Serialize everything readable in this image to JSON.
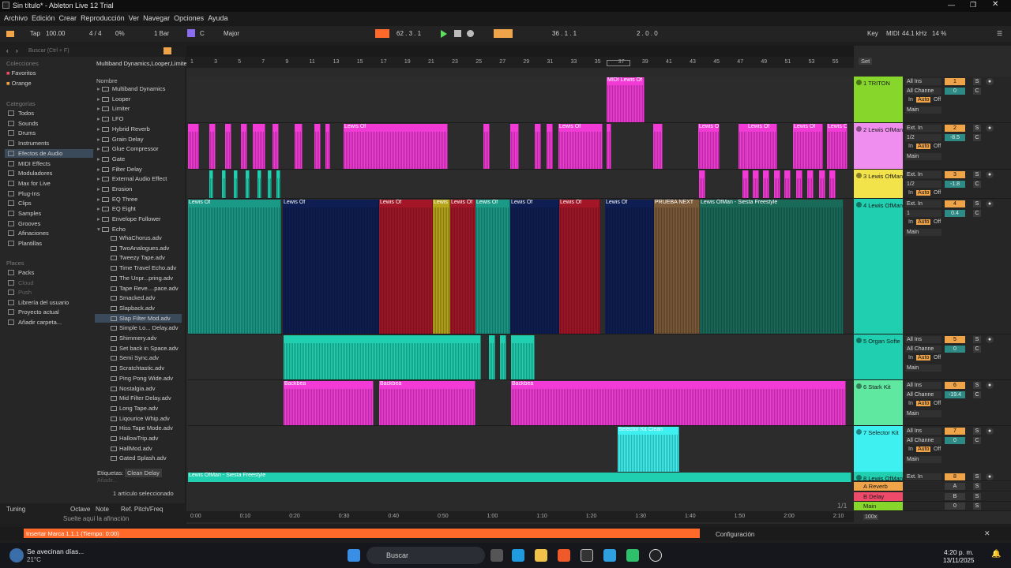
{
  "title": "Sin título* - Ableton Live 12 Trial",
  "menu": [
    "Archivo",
    "Edición",
    "Crear",
    "Reproducción",
    "Ver",
    "Navegar",
    "Opciones",
    "Ayuda"
  ],
  "toolbar": {
    "tap": "Tap",
    "tempo": "100.00",
    "sig": "4 / 4",
    "pct": "0%",
    "quant": "1 Bar",
    "key": "C",
    "scale": "Major",
    "pos": "62 . 3 . 1",
    "loop": "36 . 1 . 1",
    "len": "2 . 0 . 0",
    "key_label": "Key",
    "midi": "MIDI",
    "rate": "44.1 kHz",
    "cpu": "14 %"
  },
  "browser": {
    "search": "Buscar (Ctrl + F)",
    "devices": [
      "Multiband Dynamics",
      "Looper",
      "Limiter",
      "LFO",
      "Hybrid Reverb",
      "Grain Delay",
      "Glue Compressor",
      "Gate",
      "Filter Delay",
      "External Audio Effect",
      "Erosion",
      "EQ Three",
      "EQ Eight",
      "Envelope Follower",
      "Echo"
    ],
    "colecciones": "Colecciones",
    "favoritos": "Favoritos",
    "orange": "Orange",
    "categorias": "Categorías",
    "cats": [
      "Todos",
      "Sounds",
      "Drums",
      "Instruments",
      "Efectos de Audio",
      "MIDI Effects",
      "Moduladores",
      "Max for Live",
      "Plug-Ins",
      "Clips",
      "Samples",
      "Grooves",
      "Afinaciones",
      "Plantillas"
    ],
    "lugares": "Places",
    "places": [
      "Packs",
      "Cloud",
      "Push",
      "Librería del usuario",
      "Proyecto actual",
      "Añadir carpeta..."
    ],
    "nombre": "Nombre",
    "presets": [
      "WhaChorus.adv",
      "TwoAnalogues.adv",
      "Tweezy Tape.adv",
      "Time Travel Echo.adv",
      "The Unpr...pring.adv",
      "Tape Reve....pace.adv",
      "Smacked.adv",
      "Slapback.adv",
      "Slap Filter Mod.adv",
      "Simple Lo... Delay.adv",
      "Shimmery.adv",
      "Set back in Space.adv",
      "Semi Sync.adv",
      "Scratchtastic.adv",
      "Ping Pong Wide.adv",
      "Nostalgia.adv",
      "Mid Filter Delay.adv",
      "Long Tape.adv",
      "Liqourice Whip.adv",
      "Hiss Tape Mode.adv",
      "HallowTrip.adv",
      "HallMod.adv",
      "Gated Splash.adv"
    ],
    "etiquetas": "Etiquetas:",
    "tag": "Clean Delay",
    "anadir": "Añadir...",
    "selected": "1 artículo seleccionado",
    "tuning": "Tuning",
    "octave": "Octave",
    "note": "Note",
    "ref": "Ref. Pitch/Freq",
    "drop": "Suelte aquí la afinación"
  },
  "ruler": [
    "1",
    "3",
    "5",
    "7",
    "9",
    "11",
    "13",
    "15",
    "17",
    "19",
    "21",
    "23",
    "25",
    "27",
    "29",
    "31",
    "33",
    "35",
    "37",
    "39",
    "41",
    "43",
    "45",
    "47",
    "49",
    "51",
    "53",
    "55"
  ],
  "time": [
    "0:00",
    "0:10",
    "0:20",
    "0:30",
    "0:40",
    "0:50",
    "1:00",
    "1:10",
    "1:20",
    "1:30",
    "1:40",
    "1:50",
    "2:00",
    "2:10"
  ],
  "set": "Set",
  "tracks": [
    {
      "name": "1 TRITON",
      "color": "#86d62b",
      "in": "All Ins",
      "ch": "All Channe",
      "num": "1",
      "vol": "0"
    },
    {
      "name": "2 Lewis OfMan",
      "color": "#f08ef0",
      "in": "Ext. In",
      "ch": "1/2",
      "num": "2",
      "vol": "-8.5"
    },
    {
      "name": "3 Lewis OfMan",
      "color": "#f2e34a",
      "in": "Ext. In",
      "ch": "1/2",
      "num": "3",
      "vol": "-1.8"
    },
    {
      "name": "4 Lewis OfMan",
      "color": "#1fcfb0",
      "in": "Ext. In",
      "ch": "1",
      "num": "4",
      "vol": "0.4"
    },
    {
      "name": "5 Organ Softe",
      "color": "#1fcfb0",
      "in": "All Ins",
      "ch": "All Channe",
      "num": "5",
      "vol": "0"
    },
    {
      "name": "6 Stark Kit",
      "color": "#5ee8a0",
      "in": "All Ins",
      "ch": "All Channe",
      "num": "6",
      "vol": "-19.4"
    },
    {
      "name": "7 Selector Kit",
      "color": "#3ef0f0",
      "in": "All Ins",
      "ch": "All Channe",
      "num": "7",
      "vol": "0"
    },
    {
      "name": "8 Lewis OfMan",
      "color": "#1fcfb0",
      "in": "Ext. In",
      "ch": "",
      "num": "8",
      "vol": ""
    }
  ],
  "returns": [
    {
      "name": "A Reverb",
      "color": "#f0a44a",
      "num": "A"
    },
    {
      "name": "B Delay",
      "color": "#f04a6a",
      "num": "B"
    },
    {
      "name": "Main",
      "color": "#86d62b",
      "num": "0"
    }
  ],
  "clips": {
    "midi1": "MIDI Lewis Of",
    "lewis": "Lewis Of",
    "siesta": "Lewis OfMan - Siesta Freestyle",
    "prueba": "PRUEBA NEXT",
    "backbeat": "Backbea",
    "selector": "Selector Kit Clean",
    "siesta8": "Lewis OfMan - Siesta Freestyle"
  },
  "zoom": "1/1",
  "zoomval": "100x",
  "status": "Insertar Marca 1.1.1 (Tiempo: 0:00)",
  "config": "Configuración",
  "taskbar": {
    "weather": "Se avecinan días...",
    "temp": "21°C",
    "search": "Buscar",
    "time": "4:20 p. m.",
    "date": "13/11/2025"
  },
  "colors": {
    "accent": "#ff6a2a",
    "pink": "#f23bd6",
    "teal": "#1fcfb0",
    "cyan": "#3ef0f0",
    "green": "#86d62b"
  }
}
